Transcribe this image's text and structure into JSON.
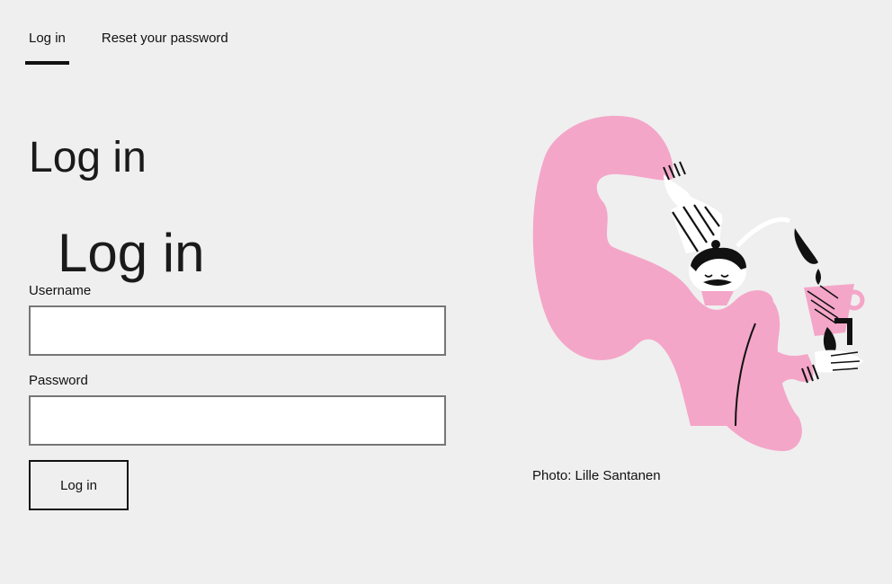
{
  "tabs": [
    {
      "label": "Log in",
      "active": true
    },
    {
      "label": "Reset your password",
      "active": false
    }
  ],
  "page_title": "Log in",
  "form": {
    "heading": "Log in",
    "username_label": "Username",
    "username_value": "",
    "password_label": "Password",
    "password_value": "",
    "submit_label": "Log in"
  },
  "illustration": {
    "icon": "chef-pouring-coffee-illustration",
    "colors": {
      "pink": "#f4a6c8",
      "ink": "#111111",
      "white": "#ffffff"
    }
  },
  "photo_credit": "Photo: Lille Santanen"
}
